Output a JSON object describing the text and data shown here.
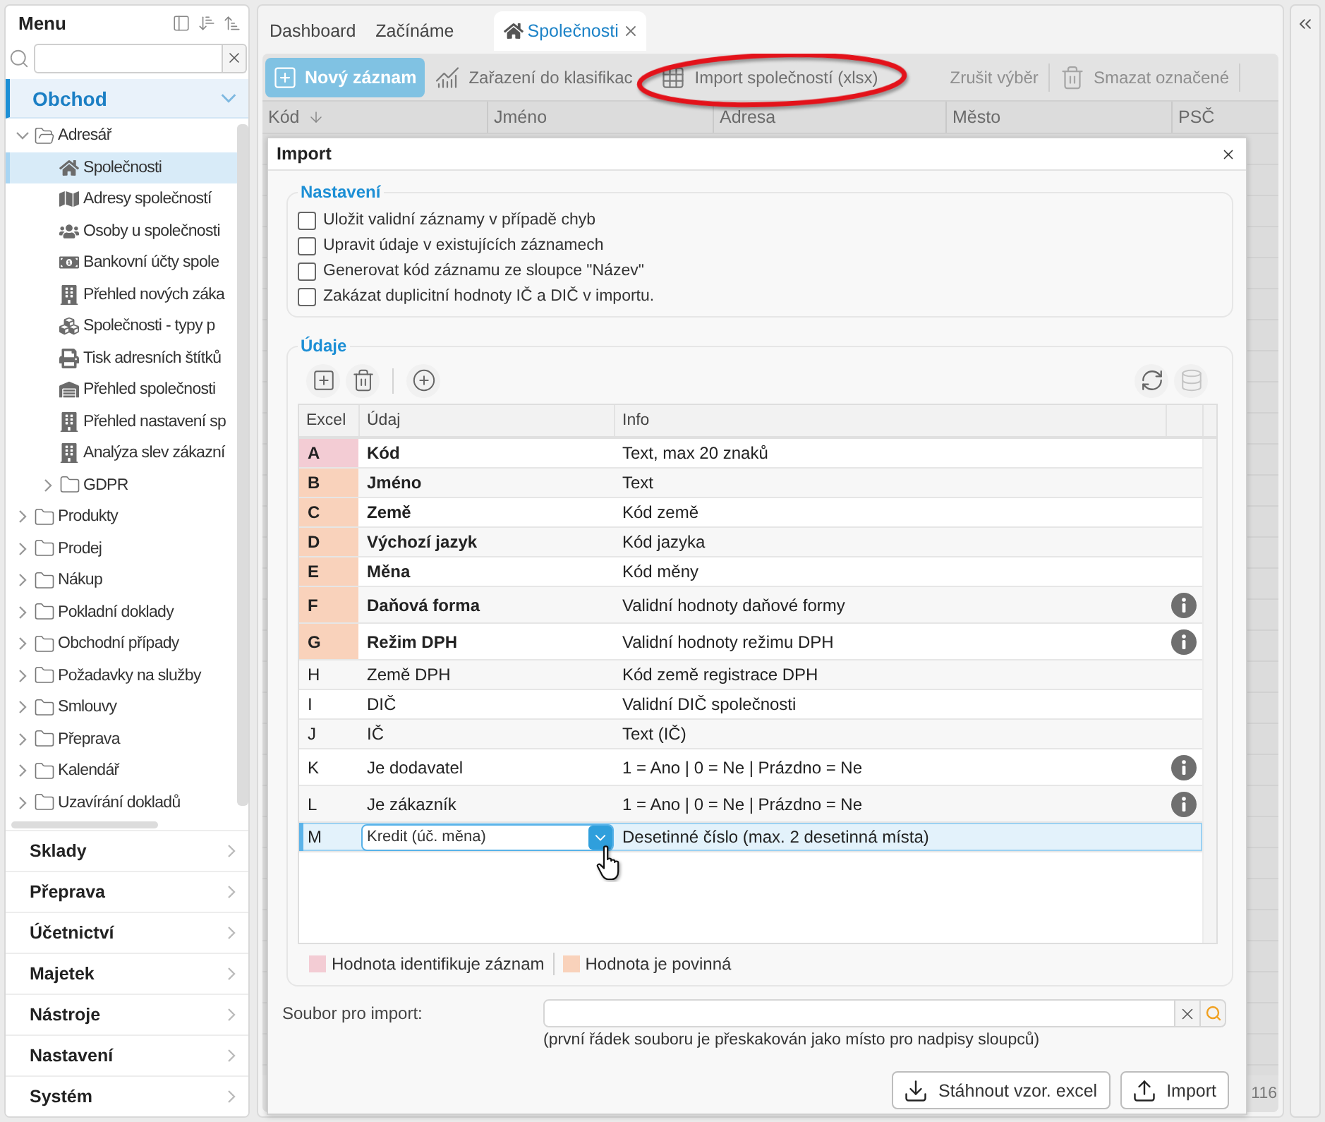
{
  "sidebar": {
    "title": "Menu",
    "sections": [
      {
        "label": "Obchod",
        "expanded": true,
        "tree": [
          {
            "label": "Adresář",
            "expanded": true,
            "selected": false,
            "children": [
              {
                "label": "Společnosti",
                "selected": true
              },
              {
                "label": "Adresy společností",
                "selected": false
              },
              {
                "label": "Osoby u společnosti",
                "selected": false
              },
              {
                "label": "Bankovní účty spole",
                "selected": false
              },
              {
                "label": "Přehled nových záka",
                "selected": false
              },
              {
                "label": "Společnosti - typy p",
                "selected": false
              },
              {
                "label": "Tisk adresních štítků",
                "selected": false
              },
              {
                "label": "Přehled společnosti",
                "selected": false
              },
              {
                "label": "Přehled nastavení sp",
                "selected": false
              },
              {
                "label": "Analýza slev zákazní",
                "selected": false
              },
              {
                "label": "GDPR",
                "expanded": false,
                "selected": false
              }
            ]
          },
          {
            "label": "Produkty",
            "expanded": false,
            "selected": false
          },
          {
            "label": "Prodej",
            "expanded": false,
            "selected": false
          },
          {
            "label": "Nákup",
            "expanded": false,
            "selected": false
          },
          {
            "label": "Pokladní doklady",
            "expanded": false,
            "selected": false
          },
          {
            "label": "Obchodní případy",
            "expanded": false,
            "selected": false
          },
          {
            "label": "Požadavky na služby",
            "expanded": false,
            "selected": false
          },
          {
            "label": "Smlouvy",
            "expanded": false,
            "selected": false
          },
          {
            "label": "Přeprava",
            "expanded": false,
            "selected": false
          },
          {
            "label": "Kalendář",
            "expanded": false,
            "selected": false
          },
          {
            "label": "Uzavírání dokladů",
            "expanded": false,
            "selected": false
          }
        ]
      },
      {
        "label": "Sklady",
        "expanded": false
      },
      {
        "label": "Přeprava",
        "expanded": false
      },
      {
        "label": "Účetnictví",
        "expanded": false
      },
      {
        "label": "Majetek",
        "expanded": false
      },
      {
        "label": "Nástroje",
        "expanded": false
      },
      {
        "label": "Nastavení",
        "expanded": false
      },
      {
        "label": "Systém",
        "expanded": false
      }
    ]
  },
  "tabs": [
    {
      "label": "Dashboard",
      "selected": false
    },
    {
      "label": "Začínáme",
      "selected": false
    },
    {
      "label": "Společnosti",
      "selected": true
    }
  ],
  "toolbar": [
    {
      "label": "Nový záznam",
      "kind": "primary",
      "disabled": false,
      "highlighted": false
    },
    {
      "label": "Zařazení do klasifikac",
      "kind": "tool",
      "disabled": false,
      "highlighted": false
    },
    {
      "label": "Import společností (xlsx)",
      "kind": "tool",
      "disabled": false,
      "highlighted": true
    },
    {
      "label": "Zrušit výběr",
      "kind": "tool",
      "disabled": true,
      "highlighted": false
    },
    {
      "label": "Smazat označené",
      "kind": "tool",
      "disabled": true,
      "highlighted": false
    }
  ],
  "grid": {
    "columns": [
      {
        "label": "Kód",
        "sorted": true
      },
      {
        "label": "Jméno",
        "sorted": false
      },
      {
        "label": "Adresa",
        "sorted": false
      },
      {
        "label": "Město",
        "sorted": false
      },
      {
        "label": "PSČ",
        "sorted": false
      }
    ],
    "footer": "116"
  },
  "dialog": {
    "title": "Import",
    "settings": {
      "legend": "Nastavení",
      "options": [
        {
          "label": "Uložit validní záznamy v případě chyb",
          "checked": false
        },
        {
          "label": "Upravit údaje v existujících záznamech",
          "checked": false
        },
        {
          "label": "Generovat kód záznamu ze sloupce \"Název\"",
          "checked": false
        },
        {
          "label": "Zakázat duplicitní hodnoty IČ a DIČ v importu.",
          "checked": false
        }
      ]
    },
    "data": {
      "legend": "Údaje",
      "columns": [
        "Excel",
        "Údaj",
        "Info"
      ],
      "rows": [
        {
          "excel": "A",
          "field": "Kód",
          "info": "Text, max 20 znaků",
          "kind": "key",
          "has_info": false,
          "selected": false
        },
        {
          "excel": "B",
          "field": "Jméno",
          "info": "Text",
          "kind": "required",
          "has_info": false,
          "selected": false
        },
        {
          "excel": "C",
          "field": "Země",
          "info": "Kód země",
          "kind": "required",
          "has_info": false,
          "selected": false
        },
        {
          "excel": "D",
          "field": "Výchozí jazyk",
          "info": "Kód jazyka",
          "kind": "required",
          "has_info": false,
          "selected": false
        },
        {
          "excel": "E",
          "field": "Měna",
          "info": "Kód měny",
          "kind": "required",
          "has_info": false,
          "selected": false
        },
        {
          "excel": "F",
          "field": "Daňová forma",
          "info": "Validní hodnoty daňové formy",
          "kind": "required",
          "has_info": true,
          "selected": false
        },
        {
          "excel": "G",
          "field": "Režim DPH",
          "info": "Validní hodnoty režimu DPH",
          "kind": "required",
          "has_info": true,
          "selected": false
        },
        {
          "excel": "H",
          "field": "Země DPH",
          "info": "Kód země registrace DPH",
          "kind": "optional",
          "has_info": false,
          "selected": false
        },
        {
          "excel": "I",
          "field": "DIČ",
          "info": "Validní DIČ společnosti",
          "kind": "optional",
          "has_info": false,
          "selected": false
        },
        {
          "excel": "J",
          "field": "IČ",
          "info": "Text (IČ)",
          "kind": "optional",
          "has_info": false,
          "selected": false
        },
        {
          "excel": "K",
          "field": "Je dodavatel",
          "info": "1 = Ano | 0 = Ne | Prázdno = Ne",
          "kind": "optional",
          "has_info": true,
          "selected": false
        },
        {
          "excel": "L",
          "field": "Je zákazník",
          "info": "1 = Ano | 0 = Ne | Prázdno = Ne",
          "kind": "optional",
          "has_info": true,
          "selected": false
        },
        {
          "excel": "M",
          "field": "Kredit (úč. měna)",
          "info": "Desetinné číslo (max. 2 desetinná místa)",
          "kind": "optional",
          "has_info": false,
          "selected": true
        }
      ],
      "legend_items": [
        {
          "kind": "key",
          "label": "Hodnota identifikuje záznam",
          "color": "#f3ccd4"
        },
        {
          "kind": "required",
          "label": "Hodnota je povinná",
          "color": "#f9d2bb"
        }
      ]
    },
    "file": {
      "label": "Soubor pro import:",
      "hint": "(první řádek souboru je přeskakován jako místo pro nadpisy sloupců)"
    },
    "buttons": [
      {
        "label": "Stáhnout vzor. excel",
        "kind": "download"
      },
      {
        "label": "Import",
        "kind": "upload"
      }
    ]
  }
}
